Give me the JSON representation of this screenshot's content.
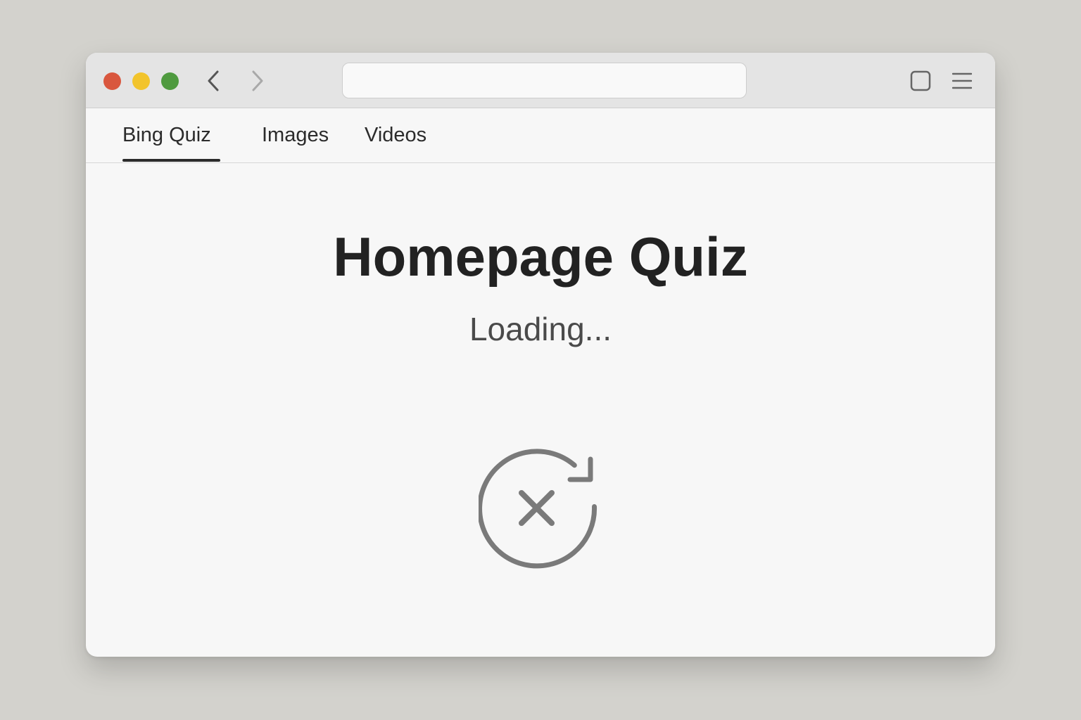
{
  "browser": {
    "address_value": "",
    "colors": {
      "close": "#d9573e",
      "minimize": "#f2c42c",
      "maximize": "#4f9a3f",
      "accent_underline": "#2b2b2b",
      "icon": "#7a7a7a"
    },
    "icons": {
      "back": "chevron-left-icon",
      "forward": "chevron-right-icon",
      "tabs": "tabs-square-icon",
      "menu": "hamburger-menu-icon"
    }
  },
  "tabs": [
    {
      "label": "Bing Quiz",
      "active": true
    },
    {
      "label": "Images",
      "active": false
    },
    {
      "label": "Videos",
      "active": false
    }
  ],
  "main": {
    "title": "Homepage Quiz",
    "status": "Loading...",
    "status_icon": "error-retry-icon"
  }
}
